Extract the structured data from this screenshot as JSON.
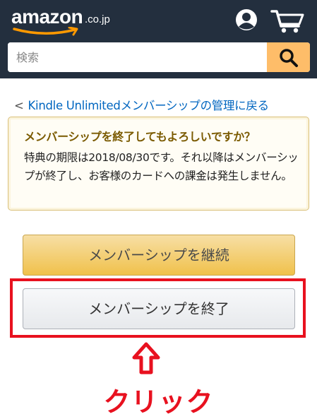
{
  "header": {
    "logo_text": "amazon",
    "logo_tld": ".co.jp",
    "icons": {
      "account": "account-icon",
      "cart": "cart-icon"
    },
    "bg_color": "#232f3e"
  },
  "search": {
    "placeholder": "検索",
    "value": "",
    "button_icon": "search-icon",
    "button_color": "#febd69"
  },
  "back_link": {
    "prefix": "<",
    "label": "Kindle Unlimitedメンバーシップの管理に戻る"
  },
  "alert": {
    "title": "メンバーシップを終了してもよろしいですか？",
    "body": "特典の期限は2018/08/30です。それ以降はメンバーシップが終了し、お客様のカードへの課金は発生しません。"
  },
  "buttons": {
    "continue_label": "メンバーシップを継続",
    "end_label": "メンバーシップを終了"
  },
  "annotation": {
    "arrow_icon": "up-arrow-icon",
    "click_label": "クリック",
    "color": "#e8111f"
  }
}
